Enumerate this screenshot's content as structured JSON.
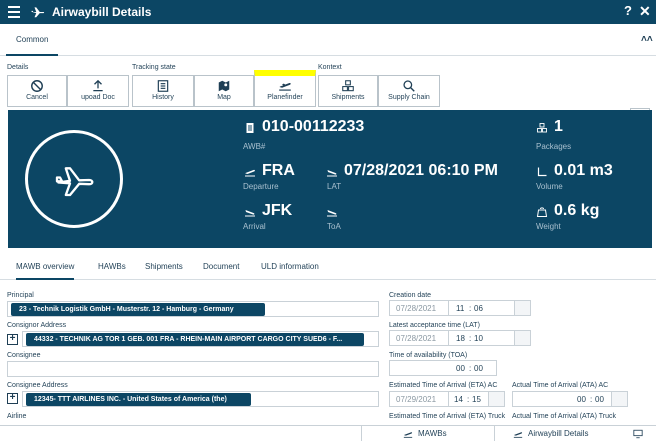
{
  "window": {
    "title": "Airwaybill Details",
    "help": "?",
    "close": "✕"
  },
  "top_tabs": {
    "common": "Common"
  },
  "toolbar": {
    "groups": {
      "details": "Details",
      "tracking": "Tracking state",
      "kontext": "Kontext"
    },
    "buttons": {
      "cancel": "Cancel",
      "upload": "upoad Doc",
      "history": "History",
      "map": "Map",
      "planefinder": "Planefinder",
      "shipments": "Shipments",
      "supply_chain": "Supply Chain"
    },
    "highlight_color": "#ffff00"
  },
  "hero": {
    "awb": {
      "value": "010-00112233",
      "label": "AWB#"
    },
    "packages": {
      "value": "1",
      "label": "Packages"
    },
    "departure": {
      "value": "FRA",
      "label": "Departure"
    },
    "lat": {
      "value": "07/28/2021 06:10 PM",
      "label": "LAT"
    },
    "volume": {
      "value": "0.01 m3",
      "label": "Volume"
    },
    "arrival": {
      "value": "JFK",
      "label": "Arrival"
    },
    "toa": {
      "label": "ToA"
    },
    "weight": {
      "value": "0.6 kg",
      "label": "Weight"
    },
    "background": "#0c4664"
  },
  "sub_tabs": [
    "MAWB overview",
    "HAWBs",
    "Shipments",
    "Document",
    "ULD information"
  ],
  "form": {
    "principal": {
      "label": "Principal",
      "value": "23 - Technik Logistik GmbH - Musterstr. 12 - Hamburg - Germany"
    },
    "consignor": {
      "label": "Consignor Address",
      "value": "44332 - TECHNIK AG TOR 1 GEB. 001 FRA - RHEIN-MAIN AIRPORT CARGO CITY SUED6 - F..."
    },
    "consignee": {
      "label": "Consignee",
      "value": ""
    },
    "consignee_address": {
      "label": "Consignee Address",
      "value": "12345- TTT AIRLINES INC. - United States of America (the)"
    },
    "airline": {
      "label": "Airline"
    },
    "creation_date": {
      "label": "Creation date",
      "date": "07/28/2021",
      "hh": "11",
      "mm": "06"
    },
    "lat_time": {
      "label": "Latest acceptance time (LAT)",
      "date": "07/28/2021",
      "hh": "18",
      "mm": "10"
    },
    "toa_time": {
      "label": "Time of availability (TOA)",
      "hh": "00",
      "mm": "00"
    },
    "eta_ac": {
      "label": "Estimated Time of Arrival (ETA) AC",
      "date": "07/29/2021",
      "hh": "14",
      "mm": "15"
    },
    "ata_ac": {
      "label": "Actual Time of Arrival (ATA) AC",
      "hh": "00",
      "mm": "00"
    },
    "eta_truck": {
      "label": "Estimated Time of Arrival (ETA) Truck"
    },
    "ata_truck": {
      "label": "Actual Time of Arrival (ATA) Truck"
    }
  },
  "bottom": {
    "mawbs": "MAWBs",
    "awb_details": "Airwaybill Details"
  }
}
